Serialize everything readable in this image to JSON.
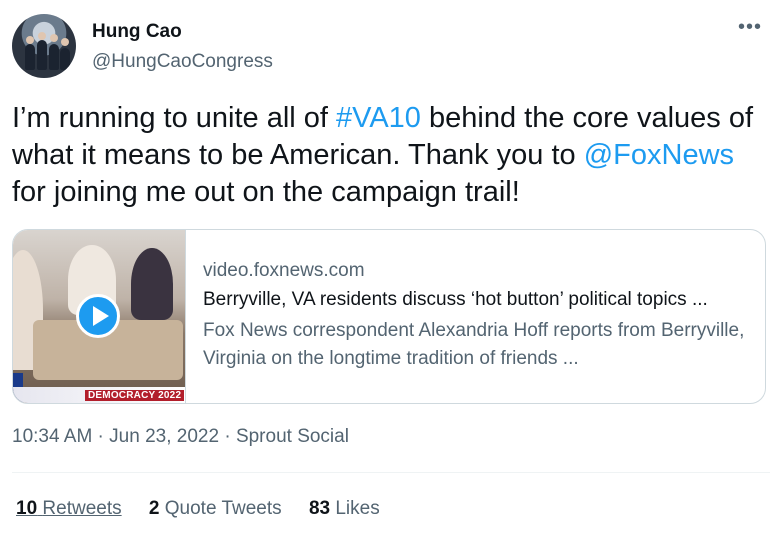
{
  "author": {
    "name": "Hung Cao",
    "handle": "@HungCaoCongress"
  },
  "more_icon": "•••",
  "tweet": {
    "text_1": "I’m running to unite all of ",
    "hashtag": "#VA10",
    "text_2": " behind the core values of what it means to be American. Thank you to ",
    "mention": "@FoxNews",
    "text_3": " for joining me out on the campaign trail!"
  },
  "card": {
    "domain": "video.foxnews.com",
    "title": "Berryville, VA residents discuss ‘hot button’ political topics ...",
    "description": "Fox News correspondent Alexandria Hoff reports from Berryville, Virginia on the longtime tradition of friends ...",
    "thumbnail_banner": "DEMOCRACY 2022"
  },
  "meta": {
    "time": "10:34 AM",
    "separator": " · ",
    "date": "Jun 23, 2022",
    "source": "Sprout Social"
  },
  "stats": {
    "retweets_count": "10",
    "retweets_label": "Retweets",
    "quotes_count": "2",
    "quotes_label": "Quote Tweets",
    "likes_count": "83",
    "likes_label": "Likes"
  },
  "colors": {
    "link": "#1d9bf0",
    "text": "#0f1419",
    "secondary": "#536471",
    "border": "#cfd9de"
  }
}
